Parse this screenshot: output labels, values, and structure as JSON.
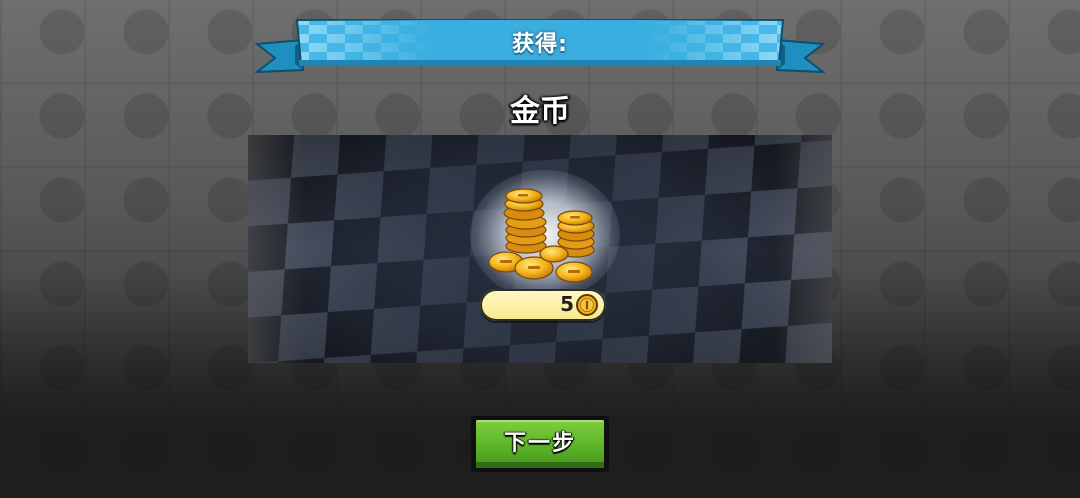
{
  "banner": {
    "title": "获得:"
  },
  "reward": {
    "item_name": "金币",
    "amount": "5",
    "icon": "gold-coin-pile-icon"
  },
  "buttons": {
    "next_label": "下一步"
  },
  "colors": {
    "banner_blue": "#3aaee0",
    "pill_yellow": "#f6e88c",
    "button_green": "#5fb72a",
    "coin_gold": "#f2b21c"
  }
}
